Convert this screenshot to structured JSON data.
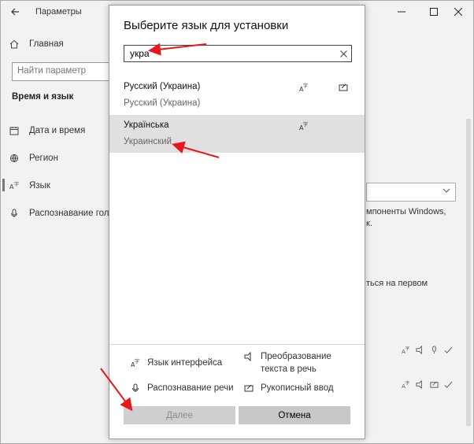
{
  "settings": {
    "window_title": "Параметры",
    "nav": {
      "home_label": "Главная",
      "search_placeholder": "Найти параметр",
      "section_label": "Время и язык",
      "items": [
        {
          "label": "Дата и время",
          "icon": "calendar-icon"
        },
        {
          "label": "Регион",
          "icon": "globe-icon"
        },
        {
          "label": "Язык",
          "icon": "language-icon"
        },
        {
          "label": "Распознавание голоса",
          "icon": "microphone-icon"
        }
      ]
    },
    "right_fragments": {
      "components_text": "мпоненты Windows,",
      "suffix_text": "к.",
      "first_text": "ться на первом"
    }
  },
  "dialog": {
    "title": "Выберите язык для установки",
    "search_value": "укра",
    "languages": [
      {
        "native": "Русский (Украина)",
        "translated": "Русский (Украина)",
        "features": [
          "display-language-icon",
          "handwriting-icon"
        ],
        "selected": false
      },
      {
        "native": "Українська",
        "translated": "Украинский",
        "features": [
          "display-language-icon"
        ],
        "selected": true
      }
    ],
    "legend": {
      "display_language": "Язык интерфейса",
      "text_to_speech": "Преобразование\nтекста в речь",
      "speech_recognition": "Распознавание речи",
      "handwriting": "Рукописный ввод"
    },
    "next_label": "Далее",
    "cancel_label": "Отмена"
  },
  "colors": {
    "annotation_arrow": "#e8161b",
    "selected_row": "#e0e0e0",
    "button_bg": "#c8c8c8"
  }
}
